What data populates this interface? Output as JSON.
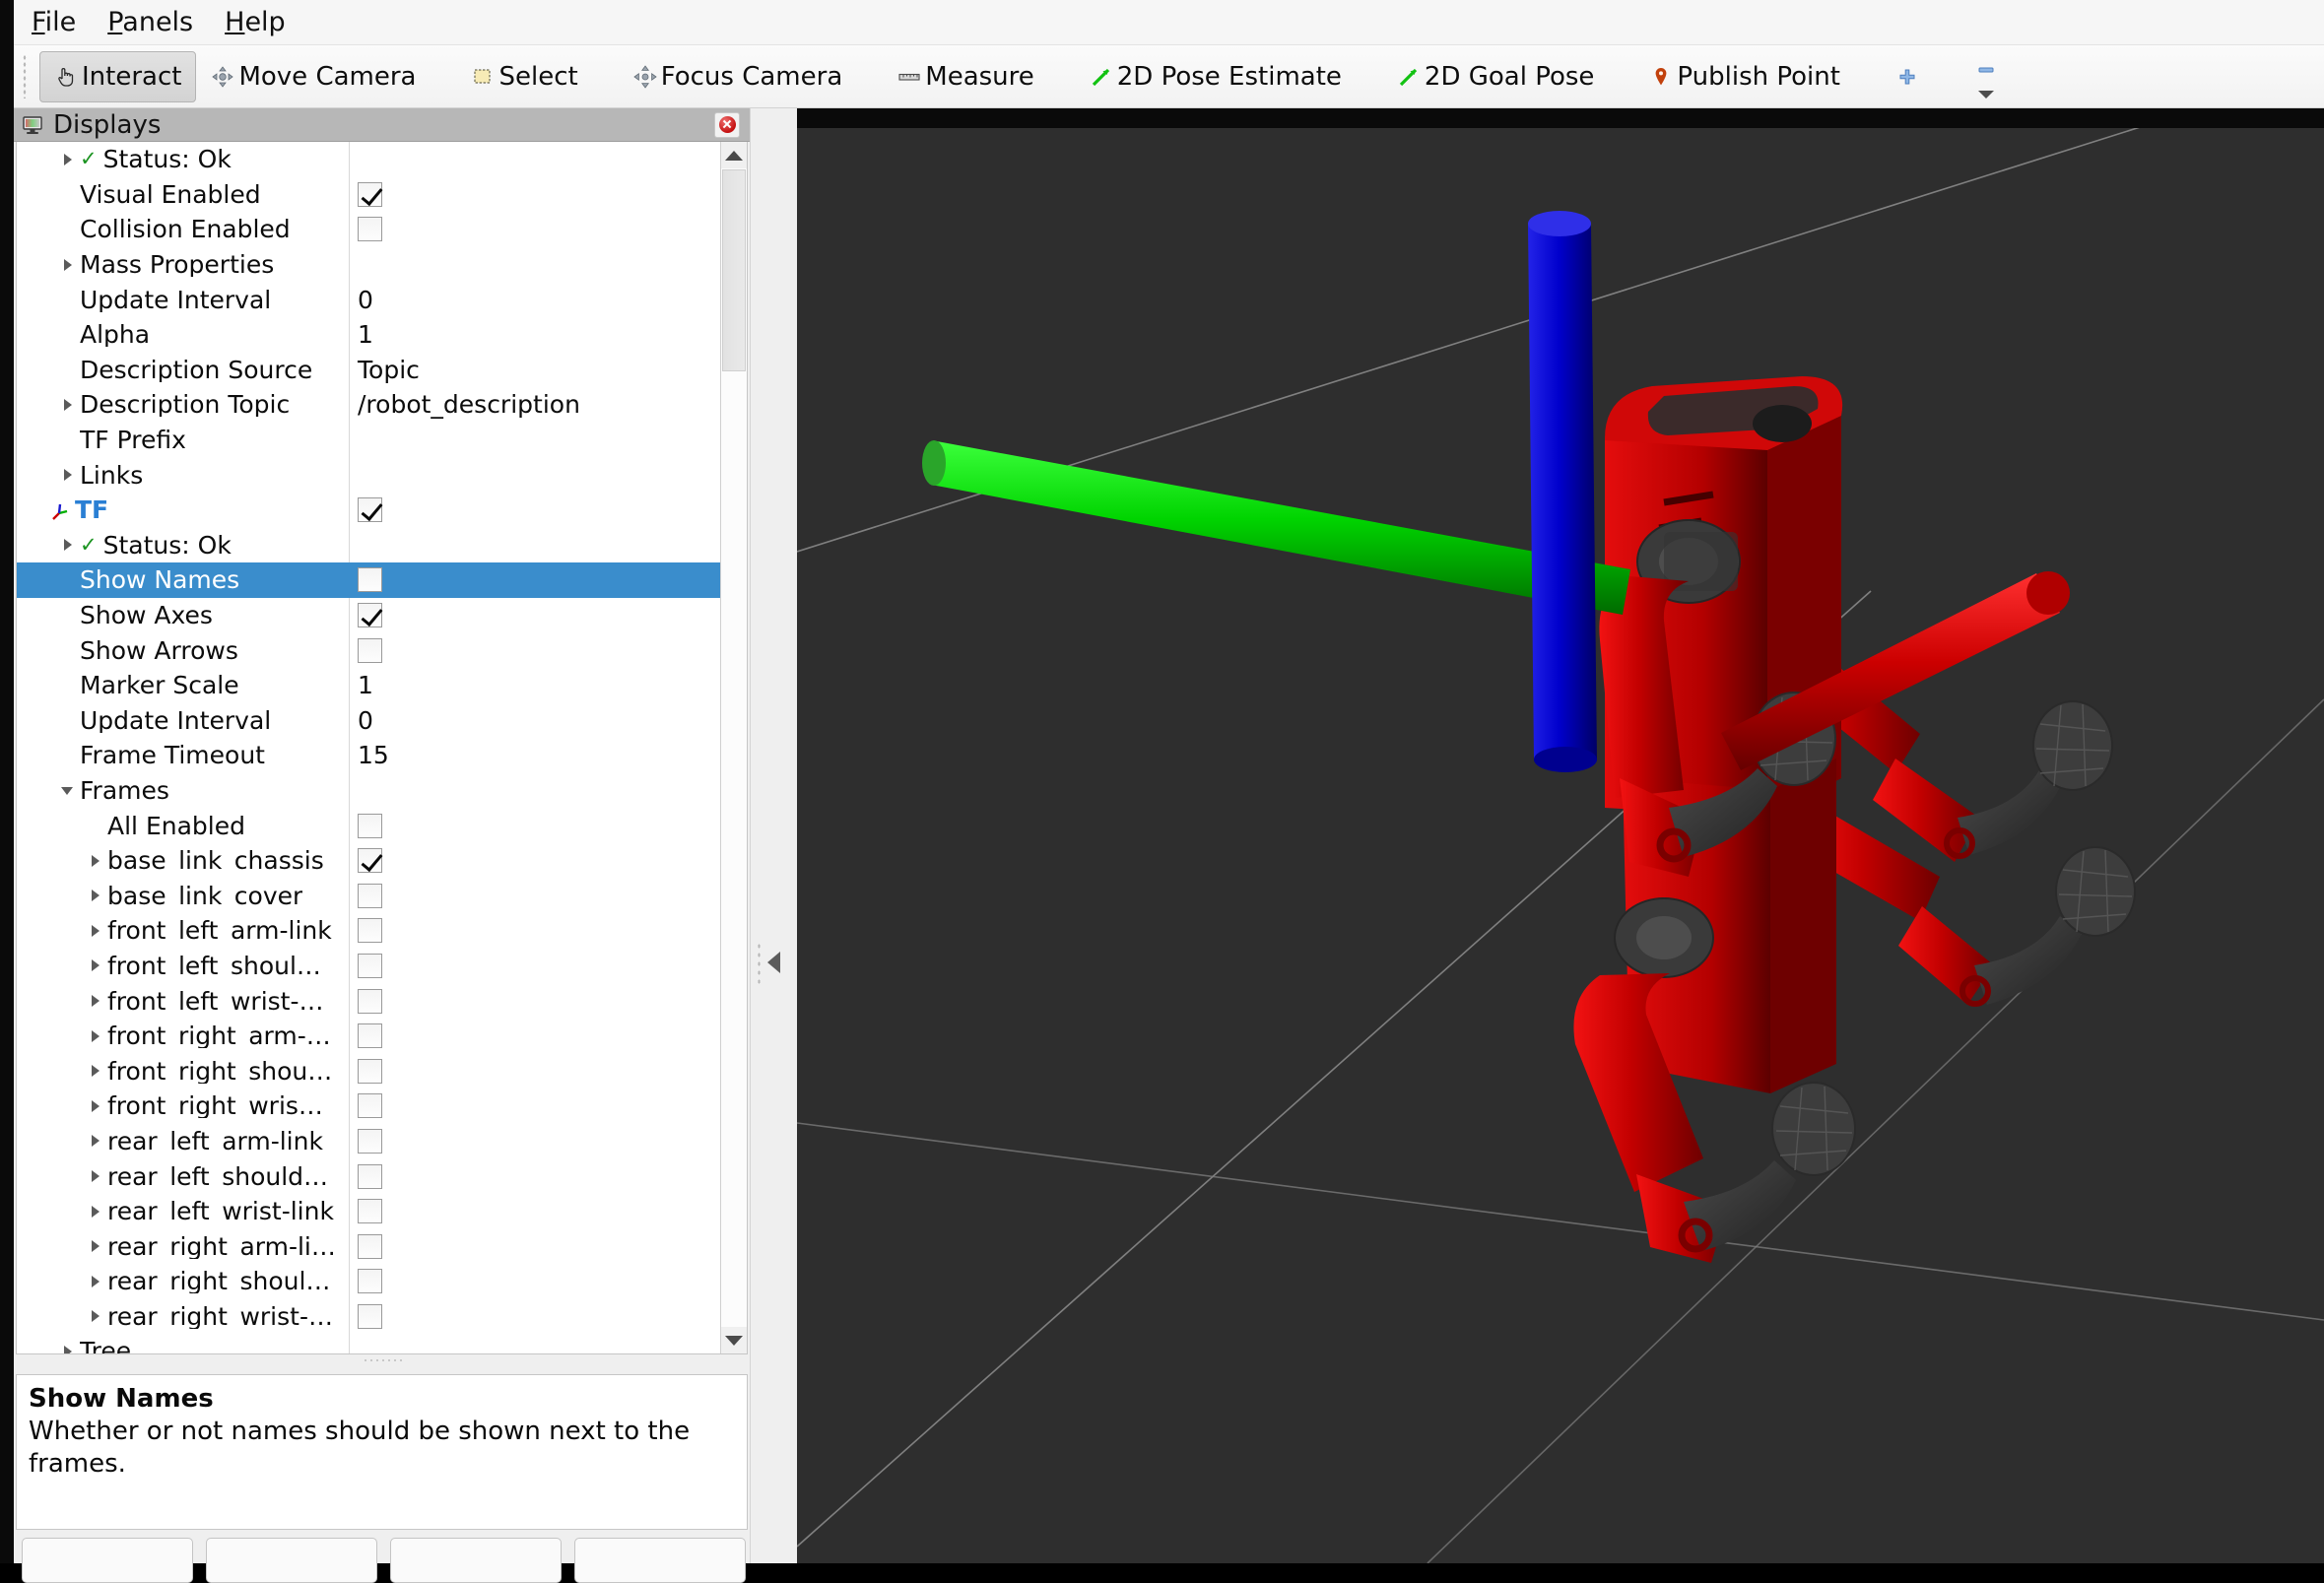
{
  "menu": {
    "items": [
      {
        "pre": "F",
        "rest": "ile"
      },
      {
        "pre": "P",
        "rest": "anels"
      },
      {
        "pre": "H",
        "rest": "elp"
      }
    ]
  },
  "toolbar": {
    "tools": [
      {
        "label": "Interact",
        "icon": "hand-cursor-icon",
        "checked": true
      },
      {
        "label": "Move Camera",
        "icon": "move-camera-icon",
        "checked": false
      },
      {
        "label": "Select",
        "icon": "select-box-icon",
        "checked": false
      },
      {
        "label": "Focus Camera",
        "icon": "focus-camera-icon",
        "checked": false
      },
      {
        "label": "Measure",
        "icon": "ruler-icon",
        "checked": false
      },
      {
        "label": "2D Pose Estimate",
        "icon": "pose-arrow-icon",
        "checked": false
      },
      {
        "label": "2D Goal Pose",
        "icon": "goal-arrow-icon",
        "checked": false
      },
      {
        "label": "Publish Point",
        "icon": "map-pin-icon",
        "checked": false
      }
    ],
    "add_tool_label": "+",
    "remove_tool_label": "−"
  },
  "displays_panel": {
    "title": "Displays",
    "icon": "monitor-icon",
    "close_icon": "close-icon",
    "rows": [
      {
        "indent": 1,
        "arrow": "closed",
        "status_ok": true,
        "label": "Status: Ok",
        "vtype": "none"
      },
      {
        "indent": 1,
        "arrow": "none",
        "label": "Visual Enabled",
        "vtype": "check",
        "checked": true
      },
      {
        "indent": 1,
        "arrow": "none",
        "label": "Collision Enabled",
        "vtype": "check",
        "checked": false
      },
      {
        "indent": 1,
        "arrow": "closed",
        "label": "Mass Properties",
        "vtype": "none"
      },
      {
        "indent": 1,
        "arrow": "none",
        "label": "Update Interval",
        "vtype": "text",
        "value": "0"
      },
      {
        "indent": 1,
        "arrow": "none",
        "label": "Alpha",
        "vtype": "text",
        "value": "1"
      },
      {
        "indent": 1,
        "arrow": "none",
        "label": "Description Source",
        "vtype": "text",
        "value": "Topic"
      },
      {
        "indent": 1,
        "arrow": "closed",
        "label": "Description Topic",
        "vtype": "text",
        "value": "/robot_description"
      },
      {
        "indent": 1,
        "arrow": "none",
        "label": "TF Prefix",
        "vtype": "none"
      },
      {
        "indent": 1,
        "arrow": "closed",
        "label": "Links",
        "vtype": "none"
      },
      {
        "indent": 0,
        "arrow": "none",
        "tf_icon": true,
        "label": "TF",
        "bold_blue": true,
        "vtype": "check",
        "checked": true
      },
      {
        "indent": 1,
        "arrow": "closed",
        "status_ok": true,
        "label": "Status: Ok",
        "vtype": "none"
      },
      {
        "indent": 1,
        "arrow": "none",
        "label": "Show Names",
        "vtype": "check",
        "checked": false,
        "selected": true
      },
      {
        "indent": 1,
        "arrow": "none",
        "label": "Show Axes",
        "vtype": "check",
        "checked": true
      },
      {
        "indent": 1,
        "arrow": "none",
        "label": "Show Arrows",
        "vtype": "check",
        "checked": false
      },
      {
        "indent": 1,
        "arrow": "none",
        "label": "Marker Scale",
        "vtype": "text",
        "value": "1"
      },
      {
        "indent": 1,
        "arrow": "none",
        "label": "Update Interval",
        "vtype": "text",
        "value": "0"
      },
      {
        "indent": 1,
        "arrow": "none",
        "label": "Frame Timeout",
        "vtype": "text",
        "value": "15"
      },
      {
        "indent": 1,
        "arrow": "open",
        "label": "Frames",
        "vtype": "none"
      },
      {
        "indent": 2,
        "arrow": "none",
        "label": "All Enabled",
        "vtype": "check",
        "checked": false
      },
      {
        "indent": 2,
        "arrow": "closed",
        "label": "base_link_chassis",
        "vtype": "check",
        "checked": true
      },
      {
        "indent": 2,
        "arrow": "closed",
        "label": "base_link_cover",
        "vtype": "check",
        "checked": false
      },
      {
        "indent": 2,
        "arrow": "closed",
        "label": "front_left_arm-link",
        "vtype": "check",
        "checked": false
      },
      {
        "indent": 2,
        "arrow": "closed",
        "label": "front_left_shoul…",
        "vtype": "check",
        "checked": false
      },
      {
        "indent": 2,
        "arrow": "closed",
        "label": "front_left_wrist-…",
        "vtype": "check",
        "checked": false
      },
      {
        "indent": 2,
        "arrow": "closed",
        "label": "front_right_arm-…",
        "vtype": "check",
        "checked": false
      },
      {
        "indent": 2,
        "arrow": "closed",
        "label": "front_right_shou…",
        "vtype": "check",
        "checked": false
      },
      {
        "indent": 2,
        "arrow": "closed",
        "label": "front_right_wris…",
        "vtype": "check",
        "checked": false
      },
      {
        "indent": 2,
        "arrow": "closed",
        "label": "rear_left_arm-link",
        "vtype": "check",
        "checked": false
      },
      {
        "indent": 2,
        "arrow": "closed",
        "label": "rear_left_should…",
        "vtype": "check",
        "checked": false
      },
      {
        "indent": 2,
        "arrow": "closed",
        "label": "rear_left_wrist-link",
        "vtype": "check",
        "checked": false
      },
      {
        "indent": 2,
        "arrow": "closed",
        "label": "rear_right_arm-li…",
        "vtype": "check",
        "checked": false
      },
      {
        "indent": 2,
        "arrow": "closed",
        "label": "rear_right_shoul…",
        "vtype": "check",
        "checked": false
      },
      {
        "indent": 2,
        "arrow": "closed",
        "label": "rear_right_wrist-…",
        "vtype": "check",
        "checked": false
      },
      {
        "indent": 1,
        "arrow": "closed",
        "label": "Tree",
        "vtype": "none"
      }
    ]
  },
  "help": {
    "title": "Show Names",
    "body": "Whether or not names should be shown next to the frames."
  },
  "bottom_buttons": [
    "",
    "",
    "",
    ""
  ],
  "viewport": {
    "background_color": "#2e2e2e",
    "grid_line_color": "#8e8e8e",
    "axes": [
      {
        "name": "x-axis",
        "color": "#cc0000"
      },
      {
        "name": "y-axis",
        "color": "#00d400"
      },
      {
        "name": "z-axis",
        "color": "#0000cc"
      }
    ],
    "robot_color": "#c20000",
    "robot_dark_color": "#3a3a3a"
  }
}
